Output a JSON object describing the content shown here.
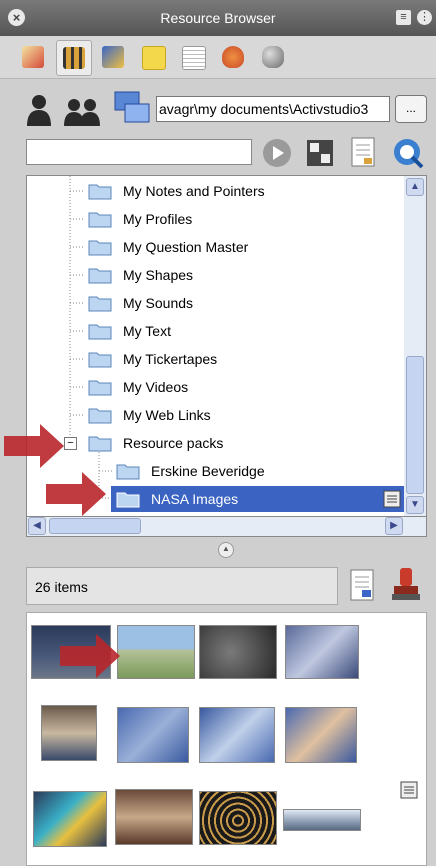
{
  "window": {
    "title": "Resource Browser"
  },
  "tabs": [
    {
      "name": "my-resources",
      "icon": "stack-icon",
      "color": "#d64a3a"
    },
    {
      "name": "shared-resources",
      "icon": "film-strip-icon",
      "color": "#d9a23a",
      "active": true
    },
    {
      "name": "pen-tool",
      "icon": "pen-icon",
      "color": "#3a66c8"
    },
    {
      "name": "notes",
      "icon": "sticky-note-icon",
      "color": "#f2d84a"
    },
    {
      "name": "document",
      "icon": "document-icon",
      "color": "#bbbbbb"
    },
    {
      "name": "spinning-top",
      "icon": "spinning-top-icon",
      "color": "#c84a2a"
    },
    {
      "name": "dice",
      "icon": "dice-icon",
      "color": "#6a6a6a"
    }
  ],
  "path": {
    "value": "avagr\\my documents\\Activstudio3",
    "browse_label": "..."
  },
  "search": {
    "value": ""
  },
  "tree": {
    "items": [
      {
        "label": "My Notes and Pointers",
        "level": 1
      },
      {
        "label": "My Profiles",
        "level": 1
      },
      {
        "label": "My Question Master",
        "level": 1
      },
      {
        "label": "My Shapes",
        "level": 1
      },
      {
        "label": "My Sounds",
        "level": 1
      },
      {
        "label": "My Text",
        "level": 1
      },
      {
        "label": "My Tickertapes",
        "level": 1
      },
      {
        "label": "My Videos",
        "level": 1
      },
      {
        "label": "My Web Links",
        "level": 1
      },
      {
        "label": "Resource packs",
        "level": 1,
        "expanded": true
      },
      {
        "label": "Erskine Beveridge",
        "level": 2
      },
      {
        "label": "NASA Images",
        "level": 2,
        "selected": true
      }
    ],
    "expander_symbol": "−"
  },
  "status": {
    "count": "26 items"
  },
  "colors": {
    "selection": "#3a63c2",
    "annotation_arrow": "#b8262a"
  }
}
